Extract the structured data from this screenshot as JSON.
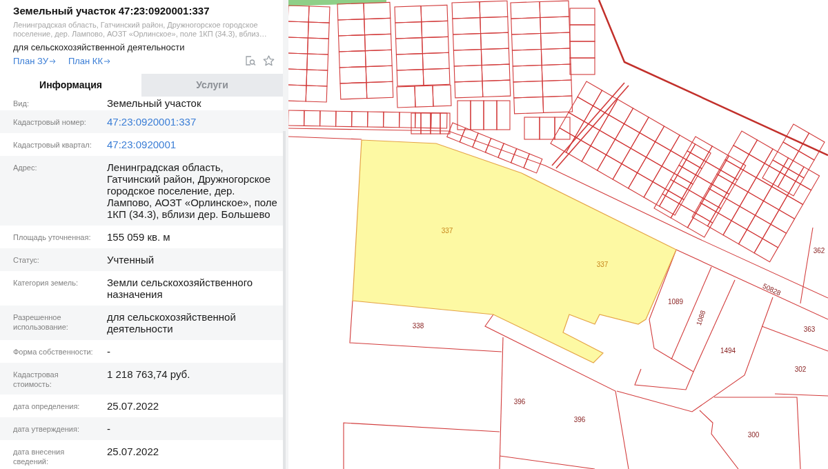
{
  "header": {
    "title": "Земельный участок 47:23:0920001:337",
    "address": "Ленинградская область, Гатчинский район, Дружногорское городское поселение, дер. Лампово, АОЗТ «Орлинское», поле 1КП (34.3), вблиз…",
    "purpose": "для сельскохозяйственной деятельности",
    "links": [
      "План ЗУ",
      "План КК"
    ]
  },
  "tabs": [
    {
      "label": "Информация",
      "selected": true
    },
    {
      "label": "Услуги",
      "selected": false
    }
  ],
  "fields": [
    {
      "label": "Вид:",
      "value": "Земельный участок",
      "kind": "text"
    },
    {
      "label": "Кадастровый номер:",
      "value": "47:23:0920001:337",
      "kind": "link"
    },
    {
      "label": "Кадастровый квартал:",
      "value": "47:23:0920001",
      "kind": "link"
    },
    {
      "label": "Адрес:",
      "value": "Ленинградская область, Гатчинский район, Дружногорское городское поселение, дер. Лампово, АОЗТ «Орлинское», поле 1КП (34.3), вблизи дер. Большево",
      "kind": "text"
    },
    {
      "label": "Площадь уточненная:",
      "value": "155 059 кв. м",
      "kind": "text"
    },
    {
      "label": "Статус:",
      "value": "Учтенный",
      "kind": "text"
    },
    {
      "label": "Категория земель:",
      "value": "Земли сельскохозяйственного назначения",
      "kind": "text"
    },
    {
      "label": "Разрешенное использование:",
      "value": "для сельскохозяйственной деятельности",
      "kind": "text"
    },
    {
      "label": "Форма собственности:",
      "value": "-",
      "kind": "text"
    },
    {
      "label": "Кадастровая стоимость:",
      "value": "1 218 763,74 руб.",
      "kind": "text"
    },
    {
      "label": "дата определения:",
      "value": "25.07.2022",
      "kind": "text"
    },
    {
      "label": "дата утверждения:",
      "value": "-",
      "kind": "text"
    },
    {
      "label": "дата внесения сведений:",
      "value": "25.07.2022",
      "kind": "text"
    }
  ],
  "map": {
    "parcels": [
      {
        "label": "337",
        "selected": true
      },
      {
        "label": "337",
        "selected": true
      },
      {
        "label": "338",
        "selected": false
      },
      {
        "label": "1089",
        "selected": false
      },
      {
        "label": "1088",
        "selected": false
      },
      {
        "label": "1494",
        "selected": false
      },
      {
        "label": "363",
        "selected": false
      },
      {
        "label": "302",
        "selected": false
      },
      {
        "label": "362",
        "selected": false
      },
      {
        "label": "396",
        "selected": false
      },
      {
        "label": "396",
        "selected": false
      },
      {
        "label": "300",
        "selected": false
      },
      {
        "label": "50828",
        "selected": false
      }
    ]
  }
}
